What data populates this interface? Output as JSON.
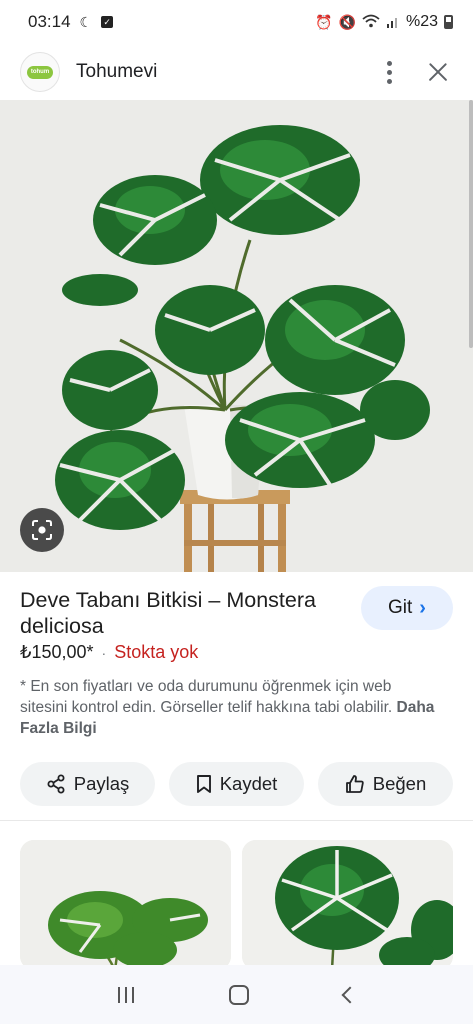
{
  "status_bar": {
    "time": "03:14",
    "battery": "%23",
    "left_icons": [
      "moon-icon",
      "check-box-icon"
    ],
    "right_icons": [
      "alarm-icon",
      "mute-icon",
      "wifi-icon",
      "signal-icon",
      "battery-icon"
    ]
  },
  "header": {
    "site_name": "Tohumevi",
    "logo_text": "tohum",
    "icons": [
      "more-vert-icon",
      "close-icon"
    ]
  },
  "product": {
    "title": "Deve Tabanı Bitkisi – Monstera deliciosa",
    "go_label": "Git",
    "price": "₺150,00*",
    "separator": "·",
    "stock": "Stokta yok",
    "notice_text": "* En son fiyatları ve oda durumunu öğrenmek için web sitesini kontrol edin. Görseller telif hakkına tabi olabilir. ",
    "notice_link": "Daha Fazla Bilgi"
  },
  "actions": {
    "share_label": "Paylaş",
    "save_label": "Kaydet",
    "like_label": "Beğen"
  },
  "colors": {
    "accent": "#1a73e8",
    "stock_red": "#c5221f",
    "chip_bg": "#f1f3f4",
    "go_bg": "#e8f0fe"
  }
}
